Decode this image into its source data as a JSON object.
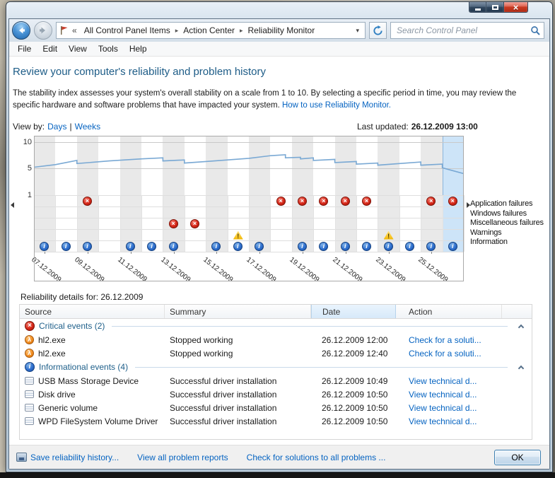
{
  "icons": {
    "close": "×",
    "dropdown": "▾",
    "breadcrumb_separator": "▸",
    "minimize": "minimize-bar",
    "maximize": "restore-box",
    "back_arrow": "white-left-arrow",
    "forward_arrow": "gray-right-arrow",
    "control_panel_flag": "flag",
    "refresh": "circular-arrow",
    "search": "magnifier",
    "scroll_left": "left-triangle",
    "scroll_right": "right-triangle",
    "collapse_group": "chevron-up",
    "critical_event": "red-circle-x",
    "warning_event": "yellow-triangle-exclamation",
    "information_event": "blue-circle-i",
    "application_hl2": "orange-lambda-circle",
    "driver_device": "device-card",
    "save_history": "disk-drive"
  },
  "glyphs": {
    "error": "×",
    "warning": "!",
    "info": "i",
    "app": "λ"
  },
  "colors": {
    "title_text": "#1d5c87",
    "link": "#0563c1",
    "chart_line": "#7aa9d4",
    "selected_day_fill": "#cde4f8",
    "stripe_gray": "#e9e9e9",
    "error_red": "#c81e1e",
    "warning_yellow": "#f2b600",
    "info_blue": "#2761c0",
    "close_button_red": "#c93a22"
  },
  "navbar": {
    "breadcrumb": {
      "overflow": "«",
      "items": [
        "All Control Panel Items",
        "Action Center",
        "Reliability Monitor"
      ]
    },
    "search_placeholder": "Search Control Panel"
  },
  "menubar": {
    "items": [
      "File",
      "Edit",
      "View",
      "Tools",
      "Help"
    ]
  },
  "page": {
    "title": "Review your computer's reliability and problem history",
    "description": "The stability index assesses your system's overall stability on a scale from 1 to 10. By selecting a specific period in time, you may review the specific hardware and software problems that have impacted your system.",
    "description_link": "How to use Reliability Monitor.",
    "view_by_label": "View by:",
    "view_days": "Days",
    "view_separator": "|",
    "view_weeks": "Weeks",
    "last_updated_label": "Last updated:",
    "last_updated_value": "26.12.2009 13:00"
  },
  "chart_data": {
    "type": "line",
    "title": "Reliability Monitor stability index timeline",
    "ylabels": [
      "10",
      "5",
      "1"
    ],
    "ylim": [
      1,
      10
    ],
    "days": 20,
    "first_day": "07.12.2009",
    "last_day": "26.12.2009",
    "selected_day": 19,
    "date_labels": [
      {
        "day": 0,
        "label": "07.12.2009"
      },
      {
        "day": 2,
        "label": "09.12.2009"
      },
      {
        "day": 4,
        "label": "11.12.2009"
      },
      {
        "day": 6,
        "label": "13.12.2009"
      },
      {
        "day": 8,
        "label": "15.12.2009"
      },
      {
        "day": 10,
        "label": "17.12.2009"
      },
      {
        "day": 12,
        "label": "19.12.2009"
      },
      {
        "day": 14,
        "label": "21.12.2009"
      },
      {
        "day": 16,
        "label": "23.12.2009"
      },
      {
        "day": 18,
        "label": "25.12.2009"
      }
    ],
    "stability": [
      [
        0,
        5.2
      ],
      [
        1,
        5.7
      ],
      [
        2,
        6.5
      ],
      [
        2,
        5.9
      ],
      [
        3.5,
        6.4
      ],
      [
        5,
        6.8
      ],
      [
        6,
        7.0
      ],
      [
        6,
        6.4
      ],
      [
        7,
        6.6
      ],
      [
        7,
        6.0
      ],
      [
        8,
        6.3
      ],
      [
        9,
        6.6
      ],
      [
        10,
        6.9
      ],
      [
        11,
        7.4
      ],
      [
        11.7,
        7.6
      ],
      [
        11.7,
        7.0
      ],
      [
        12.4,
        7.1
      ],
      [
        12.4,
        6.8
      ],
      [
        13,
        7.0
      ],
      [
        13,
        6.5
      ],
      [
        14,
        6.7
      ],
      [
        14,
        6.1
      ],
      [
        15,
        6.3
      ],
      [
        15,
        5.8
      ],
      [
        16,
        6.0
      ],
      [
        16,
        5.6
      ],
      [
        17,
        5.9
      ],
      [
        18,
        6.2
      ],
      [
        18,
        5.6
      ],
      [
        19,
        5.8
      ],
      [
        19,
        5.1
      ],
      [
        20,
        4.2
      ]
    ],
    "rows": [
      {
        "label": "Application failures",
        "icon": "error",
        "days": [
          2,
          11,
          12,
          13,
          14,
          15,
          18,
          19
        ]
      },
      {
        "label": "Windows failures",
        "icon": "error",
        "days": []
      },
      {
        "label": "Miscellaneous failures",
        "icon": "error",
        "days": [
          6,
          7
        ]
      },
      {
        "label": "Warnings",
        "icon": "warning",
        "days": [
          9,
          16
        ]
      },
      {
        "label": "Information",
        "icon": "info",
        "days": [
          0,
          1,
          2,
          4,
          5,
          6,
          8,
          9,
          10,
          12,
          13,
          14,
          15,
          16,
          17,
          18,
          19
        ]
      }
    ]
  },
  "details": {
    "heading": "Reliability details for: 26.12.2009",
    "columns": [
      "Source",
      "Summary",
      "Date",
      "Action"
    ],
    "groups": [
      {
        "icon": "critical",
        "label": "Critical events (2)",
        "rows": [
          {
            "icon": "app",
            "source": "hl2.exe",
            "summary": "Stopped working",
            "date": "26.12.2009 12:00",
            "action": "Check for a soluti..."
          },
          {
            "icon": "app",
            "source": "hl2.exe",
            "summary": "Stopped working",
            "date": "26.12.2009 12:40",
            "action": "Check for a soluti..."
          }
        ]
      },
      {
        "icon": "info",
        "label": "Informational events (4)",
        "rows": [
          {
            "icon": "driver",
            "source": "USB Mass Storage Device",
            "summary": "Successful driver installation",
            "date": "26.12.2009 10:49",
            "action": "View technical d..."
          },
          {
            "icon": "driver",
            "source": "Disk drive",
            "summary": "Successful driver installation",
            "date": "26.12.2009 10:50",
            "action": "View technical d..."
          },
          {
            "icon": "driver",
            "source": "Generic volume",
            "summary": "Successful driver installation",
            "date": "26.12.2009 10:50",
            "action": "View technical d..."
          },
          {
            "icon": "driver",
            "source": "WPD FileSystem Volume Driver",
            "summary": "Successful driver installation",
            "date": "26.12.2009 10:50",
            "action": "View technical d..."
          }
        ]
      }
    ]
  },
  "footer": {
    "links": [
      "Save reliability history...",
      "View all problem reports",
      "Check for solutions to all problems ..."
    ],
    "ok_label": "OK"
  }
}
